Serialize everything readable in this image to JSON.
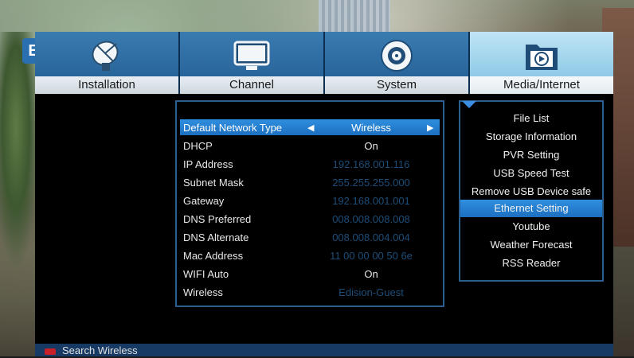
{
  "badge": "E",
  "tabs": [
    {
      "label": "Installation",
      "icon": "satellite-dish-icon"
    },
    {
      "label": "Channel",
      "icon": "tv-monitor-icon"
    },
    {
      "label": "System",
      "icon": "gear-disc-icon"
    },
    {
      "label": "Media/Internet",
      "icon": "media-folder-play-icon"
    }
  ],
  "active_tab": 3,
  "settings": [
    {
      "key": "Default Network Type",
      "value": "Wireless",
      "selected": true
    },
    {
      "key": "DHCP",
      "value": "On"
    },
    {
      "key": "IP Address",
      "value": "192.168.001.116"
    },
    {
      "key": "Subnet Mask",
      "value": "255.255.255.000"
    },
    {
      "key": "Gateway",
      "value": "192.168.001.001"
    },
    {
      "key": "DNS Preferred",
      "value": "008.008.008.008"
    },
    {
      "key": "DNS Alternate",
      "value": "008.008.004.004"
    },
    {
      "key": "Mac Address",
      "value": "11 00 00 00 50 6e"
    },
    {
      "key": "WIFI Auto",
      "value": "On"
    },
    {
      "key": "Wireless",
      "value": "Edision-Guest"
    }
  ],
  "menu": [
    {
      "label": "File List"
    },
    {
      "label": "Storage Information"
    },
    {
      "label": "PVR Setting"
    },
    {
      "label": "USB Speed Test"
    },
    {
      "label": "Remove USB Device safe"
    },
    {
      "label": "Ethernet Setting",
      "selected": true
    },
    {
      "label": "Youtube"
    },
    {
      "label": "Weather Forecast"
    },
    {
      "label": "RSS Reader"
    }
  ],
  "footer": {
    "red_key_hint": "Search Wireless"
  },
  "colors": {
    "accent": "#1d6fc0",
    "panel_border": "#2a5f8f",
    "footer": "#163a63",
    "red_key": "#c8202a"
  }
}
